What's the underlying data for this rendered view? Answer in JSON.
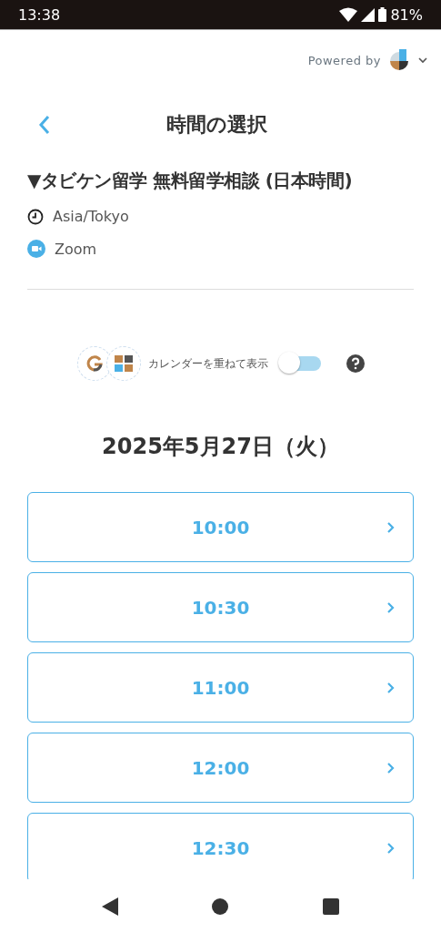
{
  "status_bar": {
    "time": "13:38",
    "battery": "81%"
  },
  "powered_by": {
    "label": "Powered by"
  },
  "header": {
    "title": "時間の選択"
  },
  "event": {
    "title": "▼タビケン留学 無料留学相談 (日本時間)",
    "timezone": "Asia/Tokyo",
    "location": "Zoom"
  },
  "calendar_overlay": {
    "label": "カレンダーを重ねて表示",
    "on": false
  },
  "date": "2025年5月27日（火）",
  "slots": [
    {
      "time": "10:00"
    },
    {
      "time": "10:30"
    },
    {
      "time": "11:00"
    },
    {
      "time": "12:00"
    },
    {
      "time": "12:30"
    }
  ]
}
